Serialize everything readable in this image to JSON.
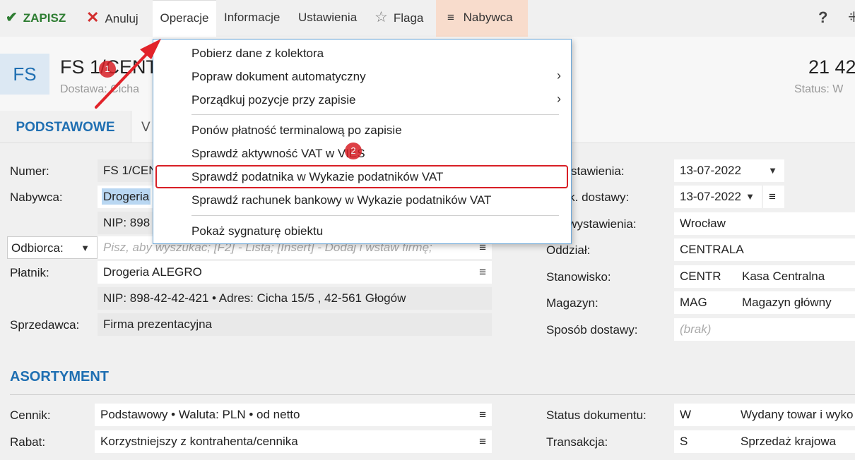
{
  "toolbar": {
    "save_label": "ZAPISZ",
    "cancel_label": "Anuluj",
    "operations_label": "Operacje",
    "info_label": "Informacje",
    "settings_label": "Ustawienia",
    "flag_label": "Flaga",
    "buyer_label": "Nabywca",
    "help_label": "?"
  },
  "header": {
    "doc_type": "FS",
    "title": "FS 1/CENT",
    "subtitle": "Dostawa: Cicha",
    "amount": "21 42",
    "status": "Status:  W"
  },
  "tabs": {
    "basic": "PODSTAWOWE",
    "second": "V"
  },
  "form": {
    "number_label": "Numer:",
    "number_value": "FS 1/CEN",
    "buyer_label": "Nabywca:",
    "buyer_value": "Drogeria",
    "buyer_nip": "NIP:  898",
    "recipient_select": "Odbiorca:",
    "recipient_placeholder": "Pisz, aby wyszukać; [F2] - Lista; [Insert] - Dodaj i wstaw firmę;",
    "payer_label": "Płatnik:",
    "payer_value": "Drogeria ALEGRO",
    "payer_details": "NIP:  898-42-42-421  •  Adres:  Cicha  15/5 , 42-561 Głogów",
    "seller_label": "Sprzedawca:",
    "seller_value": "Firma prezentacyjna",
    "issue_date_label": "a wystawienia:",
    "issue_date_value": "13-07-2022",
    "delivery_date_label": "a zak. dostawy:",
    "delivery_date_value": "13-07-2022",
    "place_label": "sce wystawienia:",
    "place_value": "Wrocław",
    "branch_label": "Oddział:",
    "branch_value": "CENTRALA",
    "station_label": "Stanowisko:",
    "station_code": "CENTR",
    "station_name": "Kasa Centralna",
    "warehouse_label": "Magazyn:",
    "warehouse_code": "MAG",
    "warehouse_name": "Magazyn główny",
    "shipping_label": "Sposób dostawy:",
    "shipping_value": "(brak)"
  },
  "assortment": {
    "section_title": "ASORTYMENT",
    "pricelist_label": "Cennik:",
    "pricelist_value": "Podstawowy • Waluta: PLN • od netto",
    "discount_label": "Rabat:",
    "discount_value": "Korzystniejszy z kontrahenta/cennika",
    "doc_status_label": "Status dokumentu:",
    "doc_status_code": "W",
    "doc_status_name": "Wydany towar i wyko",
    "transaction_label": "Transakcja:",
    "transaction_code": "S",
    "transaction_name": "Sprzedaż krajowa"
  },
  "operations_menu": {
    "items": [
      "Pobierz dane z kolektora",
      "Popraw dokument automatyczny",
      "Porządkuj pozycje przy zapisie",
      "Ponów płatność terminalową po zapisie",
      "Sprawdź aktywność VAT w VIES",
      "Sprawdź podatnika w Wykazie podatników VAT",
      "Sprawdź rachunek bankowy w Wykazie podatników VAT",
      "Pokaż sygnaturę obiektu"
    ],
    "submenu_arrow": "›"
  },
  "annotations": {
    "step1": "1",
    "step2": "2",
    "color": "#d81f26"
  }
}
